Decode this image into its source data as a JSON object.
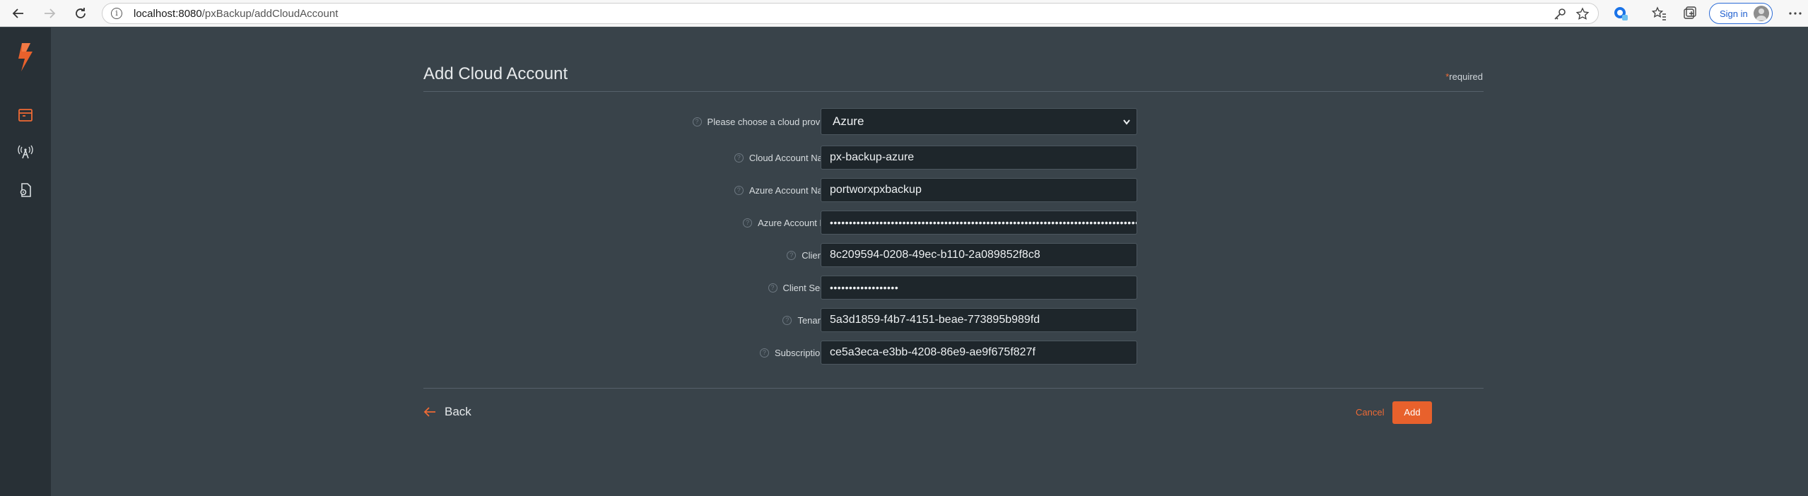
{
  "browser": {
    "url_host": "localhost:8080",
    "url_path": "/pxBackup/addCloudAccount",
    "signin_label": "Sign in"
  },
  "page": {
    "title": "Add Cloud Account",
    "required_star": "*",
    "required_note": "required"
  },
  "form": {
    "fields": [
      {
        "label": "Please choose a cloud provider",
        "value": "Azure"
      },
      {
        "label": "Cloud Account Name",
        "value": "px-backup-azure"
      },
      {
        "label": "Azure Account Name",
        "value": "portworxpxbackup"
      },
      {
        "label": "Azure Account Key",
        "value": "••••••••••••••••••••••••••••••••••••••••••••••••••••••••••••••••••••••••••••••••••••••••"
      },
      {
        "label": "Client Id",
        "value": "8c209594-0208-49ec-b110-2a089852f8c8"
      },
      {
        "label": "Client Secret",
        "value": "••••••••••••••••••"
      },
      {
        "label": "Tenant Id",
        "value": "5a3d1859-f4b7-4151-beae-773895b989fd"
      },
      {
        "label": "Subscription Id",
        "value": "ce5a3eca-e3bb-4208-86e9-ae9f675f827f"
      }
    ],
    "help_glyph": "?",
    "required_star": "*"
  },
  "footer": {
    "back_label": "Back",
    "cancel_label": "Cancel",
    "add_label": "Add"
  },
  "colors": {
    "accent": "#e8612c",
    "background": "#39434a",
    "sidebar": "#283036",
    "field_bg": "#1e262b"
  },
  "icons": {
    "sidebar": [
      "portworx-logo-icon",
      "backup-icon",
      "cloud-antenna-icon",
      "settings-doc-icon"
    ]
  }
}
